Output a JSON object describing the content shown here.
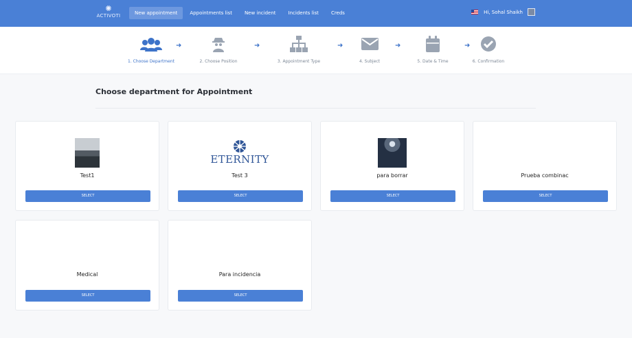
{
  "topbar": {
    "logo_text": "ACTIVOTI",
    "nav": [
      {
        "label": "New appointment",
        "active": true
      },
      {
        "label": "Appointments list",
        "active": false
      },
      {
        "label": "New incident",
        "active": false
      },
      {
        "label": "Incidents list",
        "active": false
      },
      {
        "label": "Creds",
        "active": false
      }
    ],
    "user": {
      "greeting": "Hi, Sohal Shaikh"
    }
  },
  "stepper": {
    "steps": [
      {
        "label": "1. Choose Department",
        "icon": "users-icon",
        "active": true
      },
      {
        "label": "2. Choose Position",
        "icon": "spy-icon",
        "active": false
      },
      {
        "label": "3. Appointment Type",
        "icon": "sitemap-icon",
        "active": false
      },
      {
        "label": "4. Subject",
        "icon": "envelope-icon",
        "active": false
      },
      {
        "label": "5. Date & Time",
        "icon": "calendar-icon",
        "active": false
      },
      {
        "label": "6. Confirmation",
        "icon": "check-circle-icon",
        "active": false
      }
    ]
  },
  "main": {
    "heading": "Choose department for Appointment",
    "cards": [
      {
        "name": "Test1",
        "button": "SELECT",
        "image": "photo-test1"
      },
      {
        "name": "Test 3",
        "button": "SELECT",
        "image": "eternity-logo",
        "logo_text": "ETERNITY"
      },
      {
        "name": "para borrar",
        "button": "SELECT",
        "image": "photo-borrar"
      },
      {
        "name": "Prueba combinac",
        "button": "SELECT",
        "image": null
      },
      {
        "name": "Medical",
        "button": "SELECT",
        "image": null
      },
      {
        "name": "Para incidencia",
        "button": "SELECT",
        "image": null
      }
    ]
  },
  "colors": {
    "primary": "#4a80d6",
    "active_step": "#3d73c9",
    "inactive_step": "#7c8796"
  }
}
